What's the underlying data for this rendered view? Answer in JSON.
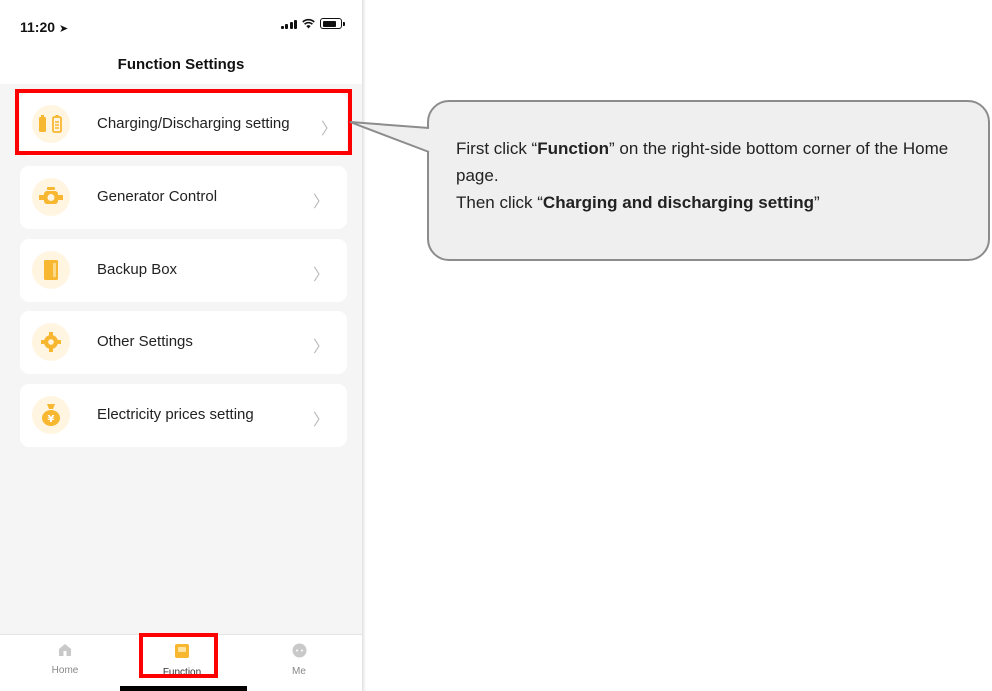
{
  "status_bar": {
    "time": "11:20",
    "location_arrow": "➤"
  },
  "header": {
    "title": "Function Settings"
  },
  "menu": {
    "items": [
      {
        "label": "Charging/Discharging setting",
        "icon": "battery-charge-icon",
        "chevron": "〉"
      },
      {
        "label": "Generator Control",
        "icon": "generator-icon",
        "chevron": "〉"
      },
      {
        "label": "Backup Box",
        "icon": "backup-box-icon",
        "chevron": "〉"
      },
      {
        "label": "Other Settings",
        "icon": "gear-icon",
        "chevron": "〉"
      },
      {
        "label": "Electricity prices setting",
        "icon": "money-bag-icon",
        "chevron": "〉"
      }
    ]
  },
  "tab_bar": {
    "tabs": [
      {
        "label": "Home",
        "icon": "home-icon",
        "active": false
      },
      {
        "label": "Function",
        "icon": "function-icon",
        "active": true
      },
      {
        "label": "Me",
        "icon": "chat-bubble-icon",
        "active": false
      }
    ]
  },
  "callout": {
    "line1_prefix": "First click “",
    "line1_bold": "Function",
    "line1_suffix": "” on the right-side bottom corner of the Home page.",
    "line2_prefix": "Then click “",
    "line2_bold": "Charging and discharging setting",
    "line2_suffix": "”"
  },
  "colors": {
    "accent": "#f7b731",
    "highlight": "#ff0000",
    "callout_fill": "#efefef",
    "callout_border": "#8c8c8c"
  }
}
